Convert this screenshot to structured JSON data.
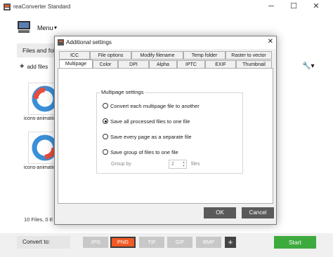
{
  "app": {
    "title": "reaConverter Standard"
  },
  "window_controls": {
    "minimize": "─",
    "maximize": "☐",
    "close": "✕"
  },
  "menu": {
    "label": "Menu",
    "caret": "▾"
  },
  "files_tab": {
    "label": "Files and fol"
  },
  "toolbar": {
    "add_files_label": "add files",
    "add_symbol": "+",
    "tools_symbol": "🔧▾"
  },
  "files": [
    {
      "label": "icons-animation"
    },
    {
      "label": "icons-animatio"
    }
  ],
  "status": {
    "text": "10 Files, 0 E"
  },
  "bottom": {
    "convert_to_label": "Convert to:",
    "formats": [
      "JPG",
      "PNG",
      "TIF",
      "GIF",
      "BMP"
    ],
    "active_format": "PNG",
    "add_format": "+",
    "start_label": "Start"
  },
  "dialog": {
    "title": "Additional settings",
    "close": "✕",
    "tabs_row1": [
      "ICC",
      "File options",
      "Modify filename",
      "Temp folder",
      "Raster to vector"
    ],
    "tabs_row2": [
      "Multipage",
      "Color",
      "DPI",
      "Alpha",
      "IPTC",
      "EXIF",
      "Thumbnail"
    ],
    "selected_tab": "Multipage",
    "group_title": "Multipage settings",
    "options": [
      {
        "label": "Convert each multipage file to another",
        "selected": false
      },
      {
        "label": "Save all processed files to one file",
        "selected": true
      },
      {
        "label": "Save every page as a separate file",
        "selected": false
      },
      {
        "label": "Save group of files to one file",
        "selected": false
      }
    ],
    "group_by_label": "Group by",
    "group_by_value": "2",
    "group_by_unit": "files",
    "ok_label": "OK",
    "cancel_label": "Cancel"
  },
  "colors": {
    "accent_active": "#f15a24",
    "start_green": "#3daa3d"
  }
}
